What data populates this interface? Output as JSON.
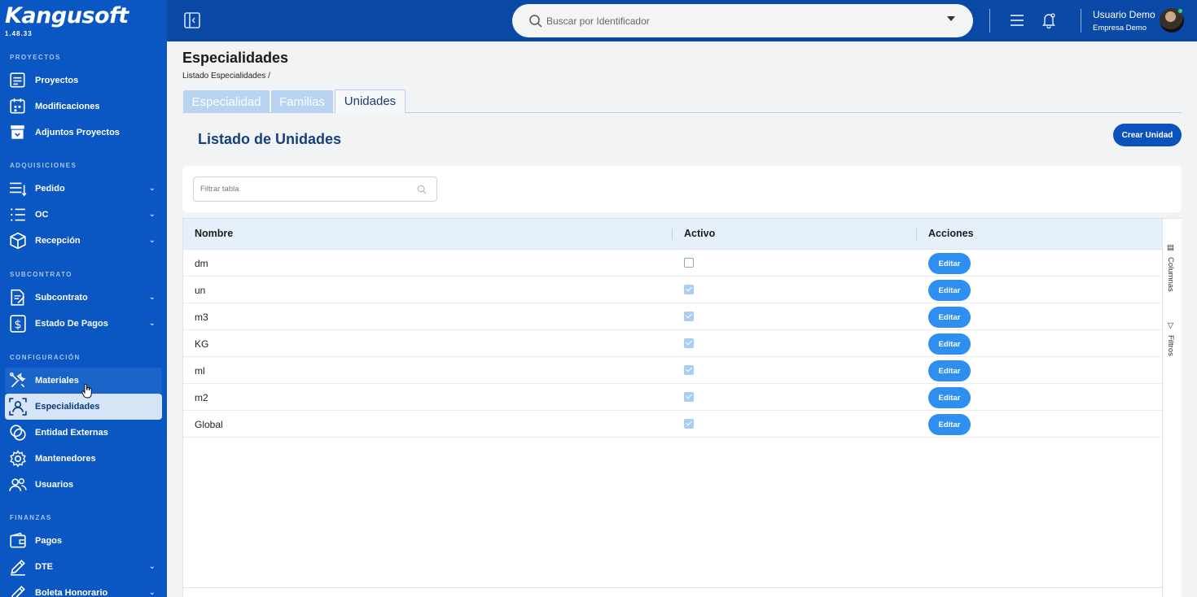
{
  "app": {
    "logo": "Kangusoft",
    "version": "1.48.33"
  },
  "header": {
    "search_placeholder": "Buscar por Identificador",
    "user_name": "Usuario Demo",
    "company": "Empresa Demo"
  },
  "sidebar": {
    "sections": [
      {
        "title": "PROYECTOS",
        "items": [
          {
            "label": "Proyectos",
            "icon": "projects-icon",
            "expandable": false
          },
          {
            "label": "Modificaciones",
            "icon": "calendar-icon",
            "expandable": false
          },
          {
            "label": "Adjuntos Proyectos",
            "icon": "archive-icon",
            "expandable": false
          }
        ]
      },
      {
        "title": "ADQUISICIONES",
        "items": [
          {
            "label": "Pedido",
            "icon": "list-icon",
            "expandable": true
          },
          {
            "label": "OC",
            "icon": "checklist-icon",
            "expandable": true
          },
          {
            "label": "Recepción",
            "icon": "box-icon",
            "expandable": true
          }
        ]
      },
      {
        "title": "SUBCONTRATO",
        "items": [
          {
            "label": "Subcontrato",
            "icon": "contract-icon",
            "expandable": true
          },
          {
            "label": "Estado De Pagos",
            "icon": "dollar-icon",
            "expandable": true
          }
        ]
      },
      {
        "title": "CONFIGURACIÓN",
        "items": [
          {
            "label": "Materiales",
            "icon": "tools-icon",
            "expandable": false
          },
          {
            "label": "Especialidades",
            "icon": "person-frame-icon",
            "expandable": false,
            "active": true
          },
          {
            "label": "Entidad Externas",
            "icon": "rings-icon",
            "expandable": false
          },
          {
            "label": "Mantenedores",
            "icon": "gear-icon",
            "expandable": false
          },
          {
            "label": "Usuarios",
            "icon": "users-icon",
            "expandable": false
          }
        ]
      },
      {
        "title": "FINANZAS",
        "items": [
          {
            "label": "Pagos",
            "icon": "wallet-icon",
            "expandable": false
          },
          {
            "label": "DTE",
            "icon": "pencil-icon",
            "expandable": true
          },
          {
            "label": "Boleta Honorario",
            "icon": "pencil-icon",
            "expandable": true
          }
        ]
      }
    ]
  },
  "page": {
    "title": "Especialidades",
    "breadcrumb": "Listado Especialidades /",
    "tabs": [
      "Especialidad",
      "Familias",
      "Unidades"
    ],
    "active_tab": "Unidades",
    "section_title": "Listado de Unidades",
    "create_button": "Crear Unidad",
    "filter_placeholder": "Filtrar tabla"
  },
  "table": {
    "columns": [
      "Nombre",
      "Activo",
      "Acciones"
    ],
    "rows": [
      {
        "nombre": "dm",
        "activo": false,
        "accion": "Editar"
      },
      {
        "nombre": "un",
        "activo": true,
        "accion": "Editar"
      },
      {
        "nombre": "m3",
        "activo": true,
        "accion": "Editar"
      },
      {
        "nombre": "KG",
        "activo": true,
        "accion": "Editar"
      },
      {
        "nombre": "ml",
        "activo": true,
        "accion": "Editar"
      },
      {
        "nombre": "m2",
        "activo": true,
        "accion": "Editar"
      },
      {
        "nombre": "Global",
        "activo": true,
        "accion": "Editar"
      }
    ],
    "side_tabs": [
      "Columnas",
      "Filtros"
    ]
  },
  "colors": {
    "sidebar": "#0a56c2",
    "header": "#0a4aa6",
    "accent": "#2e8ff0",
    "primary_button": "#0b52bd"
  }
}
